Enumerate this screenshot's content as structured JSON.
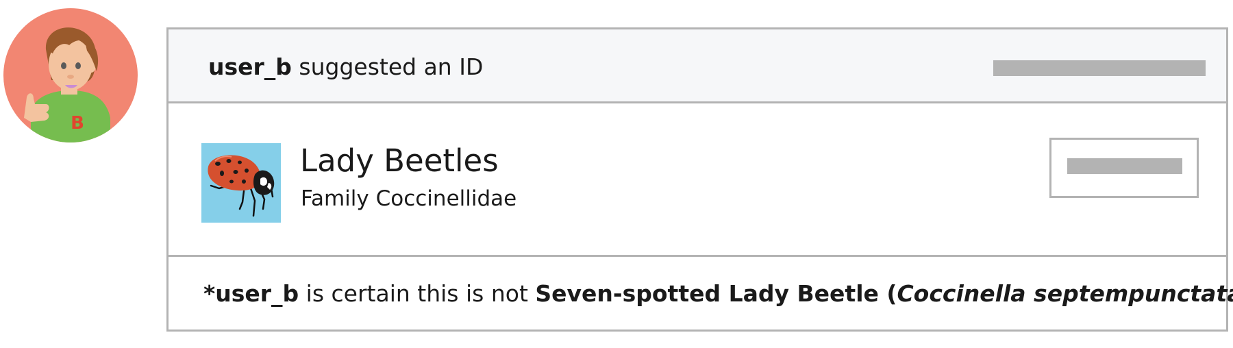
{
  "avatar": {
    "letter": "B",
    "bg_color": "#f28672",
    "shirt_color": "#76bd4f",
    "letter_color": "#e0452e",
    "icon": "user-avatar-icon"
  },
  "identification": {
    "user": "user_b",
    "action_text": " suggested an ID",
    "taxon": {
      "common_name": "Lady Beetles",
      "scientific_name": "Family Coccinellidae",
      "photo_icon": "ladybug-icon",
      "photo_bg": "#85cfe9"
    }
  },
  "footer": {
    "prefix": "*",
    "user": "user_b",
    "middle_text": " is certain this is not ",
    "taxon_common": "Seven-spotted Lady Beetle",
    "open_paren": " (",
    "taxon_scientific": "Coccinella septempunctata",
    "close_paren": ")"
  },
  "colors": {
    "border": "#b3b3b3",
    "header_bg": "#f6f7f9",
    "placeholder_bar": "#b3b3b3"
  }
}
